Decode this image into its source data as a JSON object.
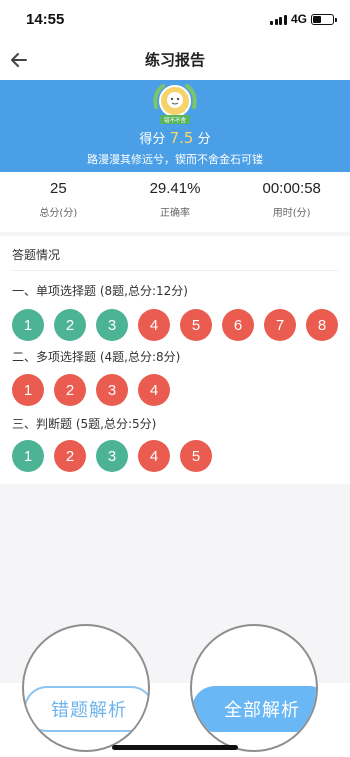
{
  "status_bar": {
    "time": "14:55",
    "network": "4G"
  },
  "nav": {
    "title": "练习报告",
    "back_icon": "arrow-left-icon"
  },
  "banner": {
    "badge_text": "错不不舍",
    "score_prefix": "得分",
    "score_value": "7.5",
    "score_unit": "分",
    "motto": "路漫漫其修远兮，锲而不舍金石可镂",
    "background_color": "#4a9fe6"
  },
  "stats": [
    {
      "value": "25",
      "label": "总分(分)"
    },
    {
      "value": "29.41%",
      "label": "正确率"
    },
    {
      "value": "00:00:58",
      "label": "用时(分)"
    }
  ],
  "answers": {
    "title": "答题情况",
    "colors": {
      "correct": "#4cb494",
      "wrong": "#ea5c4f"
    },
    "groups": [
      {
        "title": "一、单项选择题 (8题,总分:12分)",
        "items": [
          {
            "n": "1",
            "status": "correct"
          },
          {
            "n": "2",
            "status": "correct"
          },
          {
            "n": "3",
            "status": "correct"
          },
          {
            "n": "4",
            "status": "wrong"
          },
          {
            "n": "5",
            "status": "wrong"
          },
          {
            "n": "6",
            "status": "wrong"
          },
          {
            "n": "7",
            "status": "wrong"
          },
          {
            "n": "8",
            "status": "wrong"
          }
        ]
      },
      {
        "title": "二、多项选择题 (4题,总分:8分)",
        "items": [
          {
            "n": "1",
            "status": "wrong"
          },
          {
            "n": "2",
            "status": "wrong"
          },
          {
            "n": "3",
            "status": "wrong"
          },
          {
            "n": "4",
            "status": "wrong"
          }
        ]
      },
      {
        "title": "三、判断题 (5题,总分:5分)",
        "items": [
          {
            "n": "1",
            "status": "correct"
          },
          {
            "n": "2",
            "status": "wrong"
          },
          {
            "n": "3",
            "status": "correct"
          },
          {
            "n": "4",
            "status": "wrong"
          },
          {
            "n": "5",
            "status": "wrong"
          }
        ]
      }
    ]
  },
  "bottom": {
    "wrong_analysis_label": "错题解析",
    "all_analysis_label": "全部解析"
  }
}
